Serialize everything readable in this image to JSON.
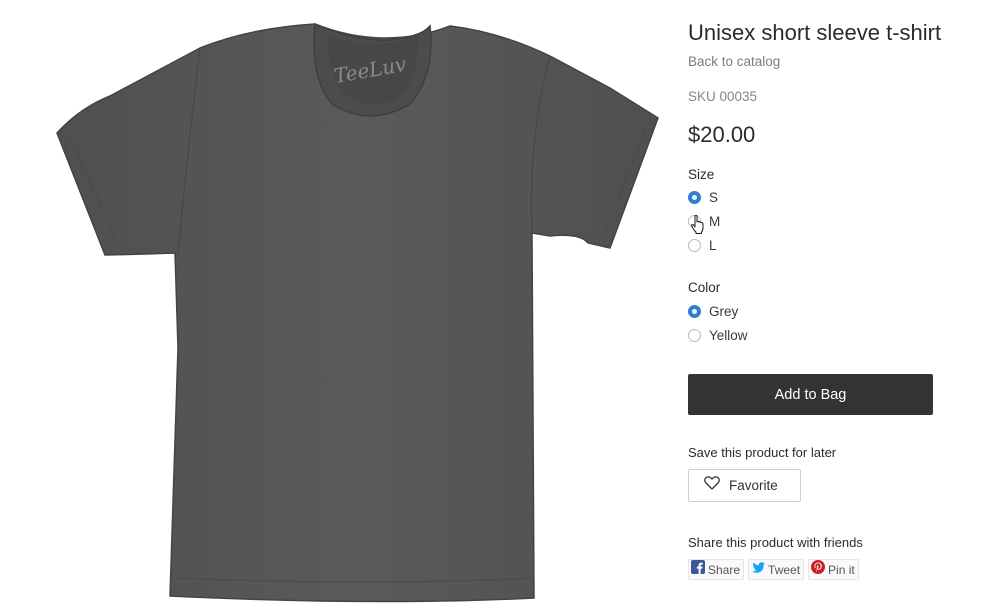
{
  "product": {
    "title": "Unisex short sleeve t-shirt",
    "back_link": "Back to catalog",
    "sku": "SKU 00035",
    "price": "$20.00",
    "image_alt": "Grey t-shirt",
    "brand_logo": "TeeLuv",
    "color_hex": "#565656"
  },
  "size": {
    "label": "Size",
    "options": [
      {
        "label": "S",
        "checked": true
      },
      {
        "label": "M",
        "checked": false
      },
      {
        "label": "L",
        "checked": false
      }
    ]
  },
  "color": {
    "label": "Color",
    "options": [
      {
        "label": "Grey",
        "checked": true
      },
      {
        "label": "Yellow",
        "checked": false
      }
    ]
  },
  "add_to_bag": {
    "label": "Add to Bag",
    "color": "#333333"
  },
  "save": {
    "label": "Save this product for later",
    "favorite_label": "Favorite",
    "icon": "heart-icon"
  },
  "share": {
    "label": "Share this product with friends",
    "buttons": [
      {
        "label": "Share",
        "icon": "facebook-icon",
        "color": "#3b5998"
      },
      {
        "label": "Tweet",
        "icon": "twitter-icon",
        "color": "#1da1f2"
      },
      {
        "label": "Pin it",
        "icon": "pinterest-icon",
        "color": "#cb2027"
      }
    ]
  },
  "accent_color": "#2f80cf"
}
